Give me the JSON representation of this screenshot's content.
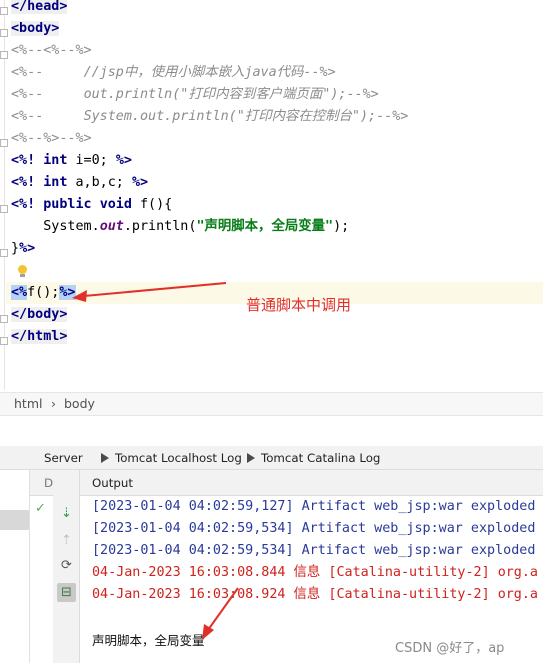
{
  "editor": {
    "lines": {
      "l1": "</head>",
      "l2": "<body>",
      "l3": "<%--<%--%>",
      "l4_a": "<%--     ",
      "l4_b": "//jsp中，使用小脚本嵌入java代码--%>",
      "l5_a": "<%--     ",
      "l5_b": "out.println(\"打印内容到客户端页面\");--%>",
      "l6_a": "<%--     ",
      "l6_b": "System.out.println(\"打印内容在控制台\");--%>",
      "l7": "<%--%>--%>",
      "l8_open": "<%!",
      "l8_kw": "int",
      "l8_rest": " i=0; ",
      "l8_close": "%>",
      "l9_open": "<%!",
      "l9_kw": "int",
      "l9_rest": " a,b,c; ",
      "l9_close": "%>",
      "l10_open": "<%!",
      "l10_kw1": "public",
      "l10_kw2": "void",
      "l10_rest": " f(){",
      "l11_a": "    System.",
      "l11_out": "out",
      "l11_b": ".println(",
      "l11_str": "\"声明脚本，全局变量\"",
      "l11_c": ");",
      "l12_a": "}",
      "l12_b": "%>",
      "l14_open": "<%",
      "l14_mid": "f();",
      "l14_close": "%>",
      "l15": "</body>",
      "l16": "</html>"
    },
    "annotation": "普通脚本中调用"
  },
  "breadcrumb": {
    "item1": "html",
    "sep": "›",
    "item2": "body"
  },
  "run_panel": {
    "tabs": {
      "server": "Server",
      "localhost_log": "Tomcat Localhost Log",
      "catalina_log": "Tomcat Catalina Log"
    },
    "col_d": "D",
    "col_output": "Output",
    "logs": [
      "[2023-01-04 04:02:59,127] Artifact web_jsp:war exploded",
      "[2023-01-04 04:02:59,534] Artifact web_jsp:war exploded",
      "[2023-01-04 04:02:59,534] Artifact web_jsp:war exploded",
      "04-Jan-2023 16:03:08.844 信息 [Catalina-utility-2] org.a",
      "04-Jan-2023 16:03:08.924 信息 [Catalina-utility-2] org.a"
    ],
    "output_text": "声明脚本，全局变量"
  },
  "watermark": "CSDN @好了，ap",
  "colors": {
    "annotation": "#e0302c",
    "log_info": "#2a3a9a",
    "log_error": "#d0211c",
    "string": "#067d17",
    "keyword": "#000080"
  }
}
